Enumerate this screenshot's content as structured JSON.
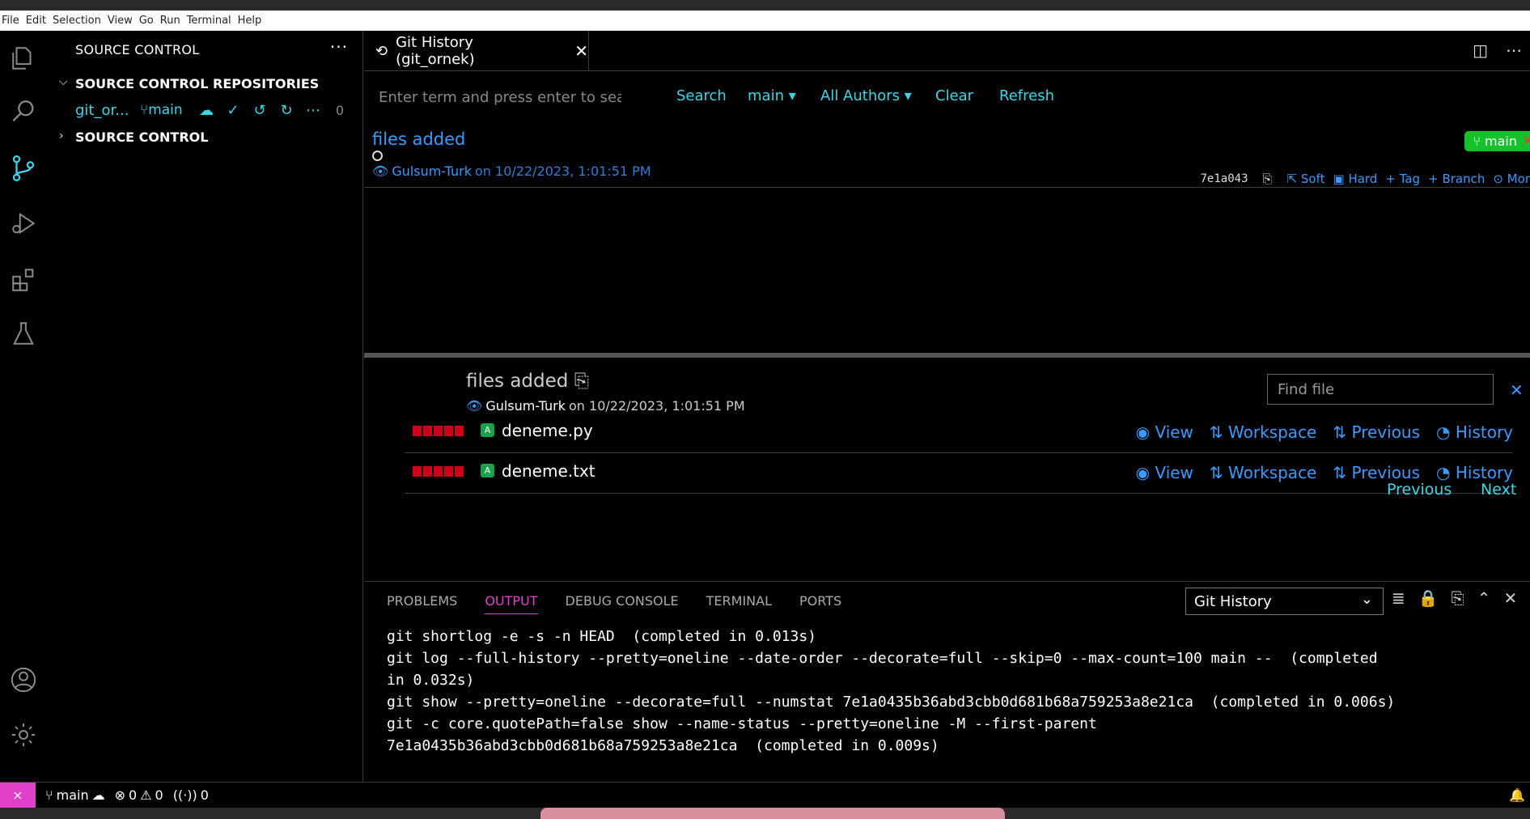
{
  "menu": [
    "File",
    "Edit",
    "Selection",
    "View",
    "Go",
    "Run",
    "Terminal",
    "Help"
  ],
  "sidebar": {
    "title": "SOURCE CONTROL",
    "more": "···",
    "repos_section": "SOURCE CONTROL REPOSITORIES",
    "repo_name": "git_or...",
    "repo_branch": "main",
    "repo_count": "0",
    "sc_section": "SOURCE CONTROL"
  },
  "tab": {
    "title": "Git History (git_ornek)"
  },
  "toolbar": {
    "search_placeholder": "Enter term and press enter to search",
    "search": "Search",
    "branch": "main",
    "authors": "All Authors",
    "clear": "Clear",
    "refresh": "Refresh"
  },
  "commit": {
    "title": "files added",
    "author": "Gulsum-Turk",
    "date": "on 10/22/2023, 1:01:51 PM",
    "branch": "main",
    "hash": "7e1a043",
    "soft": "Soft",
    "hard": "Hard",
    "tag": "Tag",
    "branch_btn": "Branch",
    "more": "Mor"
  },
  "details": {
    "title": "files added",
    "author": "Gulsum-Turk",
    "date": "on 10/22/2023, 1:01:51 PM",
    "find_placeholder": "Find file",
    "files": [
      {
        "name": "deneme.py",
        "status": "A"
      },
      {
        "name": "deneme.txt",
        "status": "A"
      }
    ],
    "actions": {
      "view": "View",
      "workspace": "Workspace",
      "previous": "Previous",
      "history": "History"
    },
    "prev_page": "Previous",
    "next_page": "Next"
  },
  "panel": {
    "tabs": [
      "PROBLEMS",
      "OUTPUT",
      "DEBUG CONSOLE",
      "TERMINAL",
      "PORTS"
    ],
    "active_tab": "OUTPUT",
    "output_channel": "Git History",
    "log": "git shortlog -e -s -n HEAD  (completed in 0.013s)\ngit log --full-history --pretty=oneline --date-order --decorate=full --skip=0 --max-count=100 main --  (completed\nin 0.032s)\ngit show --pretty=oneline --decorate=full --numstat 7e1a0435b36abd3cbb0d681b68a759253a8e21ca  (completed in 0.006s)\ngit -c core.quotePath=false show --name-status --pretty=oneline -M --first-parent\n7e1a0435b36abd3cbb0d681b68a759253a8e21ca  (completed in 0.009s)"
  },
  "status": {
    "branch": "main",
    "errors": "0",
    "warnings": "0",
    "ports": "0"
  }
}
